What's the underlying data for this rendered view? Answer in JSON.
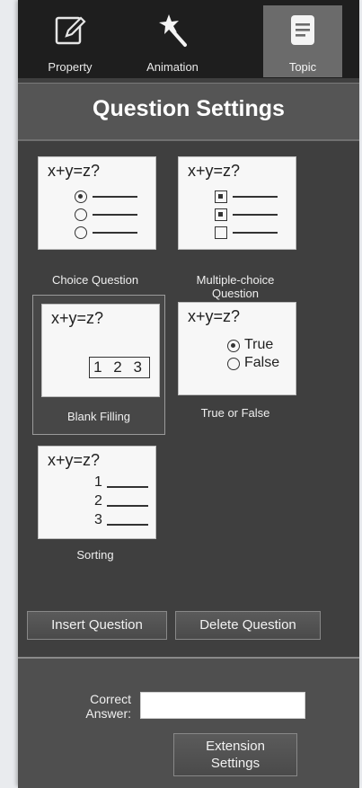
{
  "tabs": [
    {
      "label": "Property",
      "icon": "edit-icon",
      "active": false
    },
    {
      "label": "Animation",
      "icon": "magic-wand-icon",
      "active": false
    },
    {
      "label": "Topic",
      "icon": "document-icon",
      "active": true
    }
  ],
  "header": {
    "title": "Question Settings"
  },
  "questions": {
    "choice": {
      "formula": "x+y=z?",
      "label": "Choice Question"
    },
    "multiple": {
      "formula": "x+y=z?",
      "label_line1": "Multiple-choice",
      "label_line2": "Question"
    },
    "blank": {
      "formula": "x+y=z?",
      "blank_text": "1 2 3",
      "label": "Blank Filling",
      "selected": true
    },
    "truefalse": {
      "formula": "x+y=z?",
      "true_text": "True",
      "false_text": "False",
      "label": "True or False"
    },
    "sorting": {
      "formula": "x+y=z?",
      "items": [
        "1",
        "2",
        "3"
      ],
      "label": "Sorting"
    }
  },
  "actions": {
    "insert_label": "Insert Question",
    "delete_label": "Delete Question"
  },
  "answer": {
    "label_line1": "Correct",
    "label_line2": "Answer:",
    "value": ""
  },
  "extension": {
    "label_line1": "Extension",
    "label_line2": "Settings"
  },
  "colors": {
    "panel": "#3f3f3f",
    "tabbar": "#1e1e1e",
    "active_tab": "#6b6b6b",
    "header": "#555555"
  }
}
